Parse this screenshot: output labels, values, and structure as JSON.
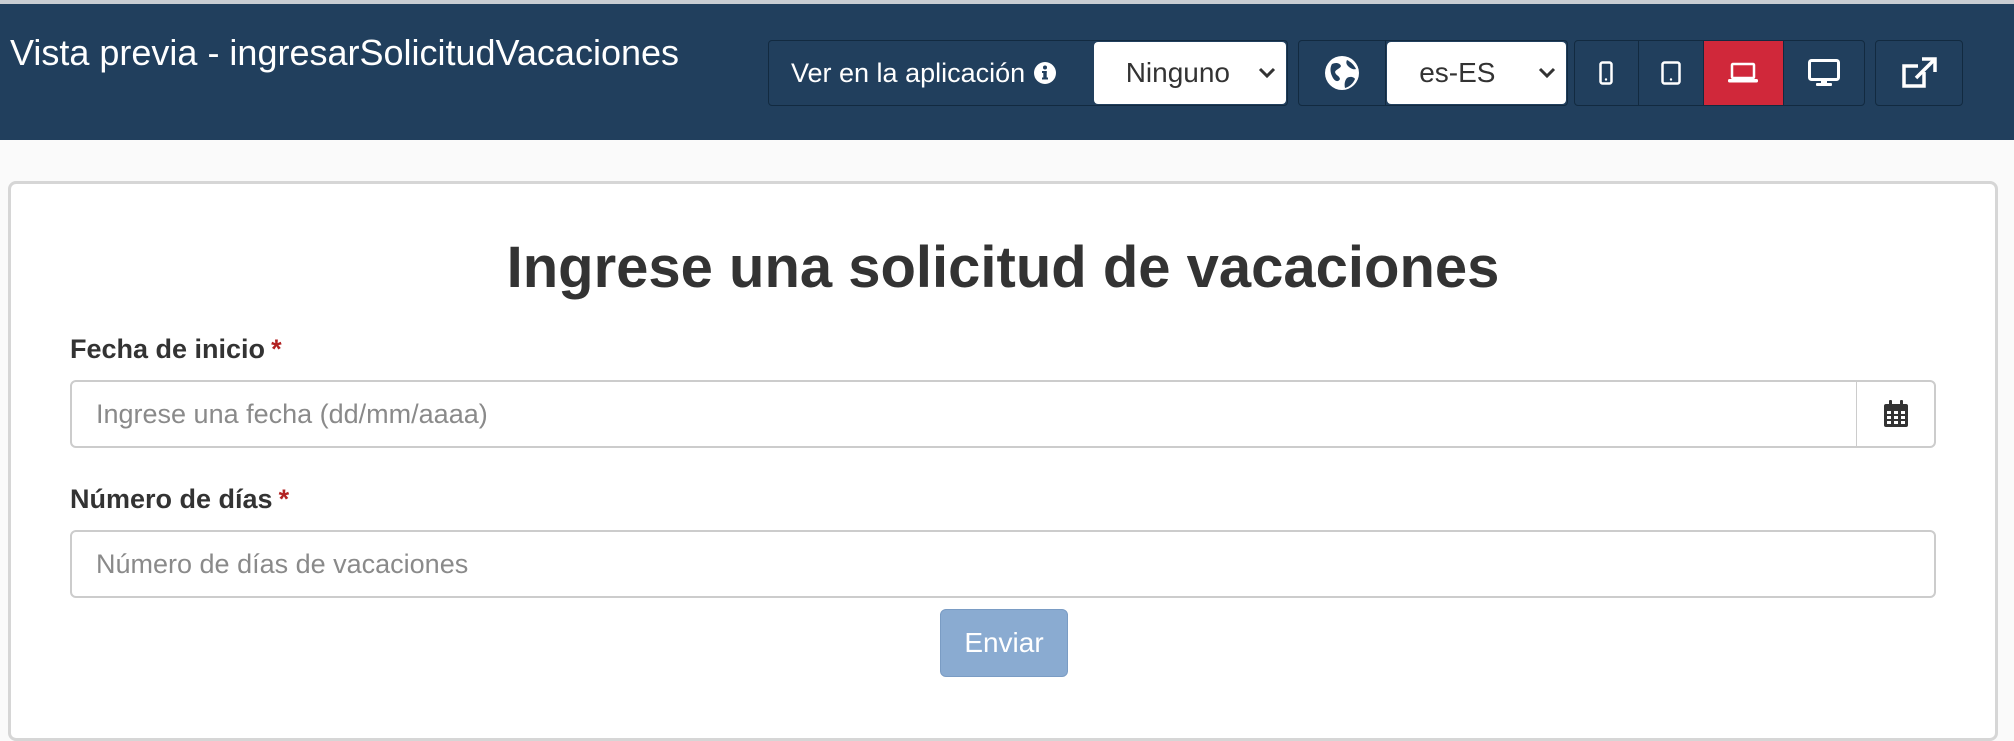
{
  "header": {
    "title": "Vista previa - ingresarSolicitudVacaciones",
    "view_in_app_label": "Ver en la aplicación",
    "app_select_value": "Ninguno",
    "locale_select_value": "es-ES",
    "icons": {
      "info": "info-circle-icon",
      "globe": "globe-icon",
      "phone": "mobile-phone-icon",
      "tablet": "tablet-icon",
      "laptop": "laptop-icon",
      "desktop": "desktop-icon",
      "external": "external-link-icon",
      "select_arrow": "chevron-down-icon"
    },
    "active_device": "laptop",
    "colors": {
      "bar": "#213f5d",
      "active_device": "#d0283a"
    }
  },
  "form": {
    "title": "Ingrese una solicitud de vacaciones",
    "required_marker": "*",
    "fields": [
      {
        "label": "Fecha de inicio",
        "placeholder": "Ingrese una fecha (dd/mm/aaaa)",
        "value": "",
        "icon": "calendar-icon"
      },
      {
        "label": "Número de días",
        "placeholder": "Número de días de vacaciones",
        "value": ""
      }
    ],
    "submit_label": "Enviar",
    "colors": {
      "submit": "#8aabd1",
      "required": "#b22222"
    }
  }
}
